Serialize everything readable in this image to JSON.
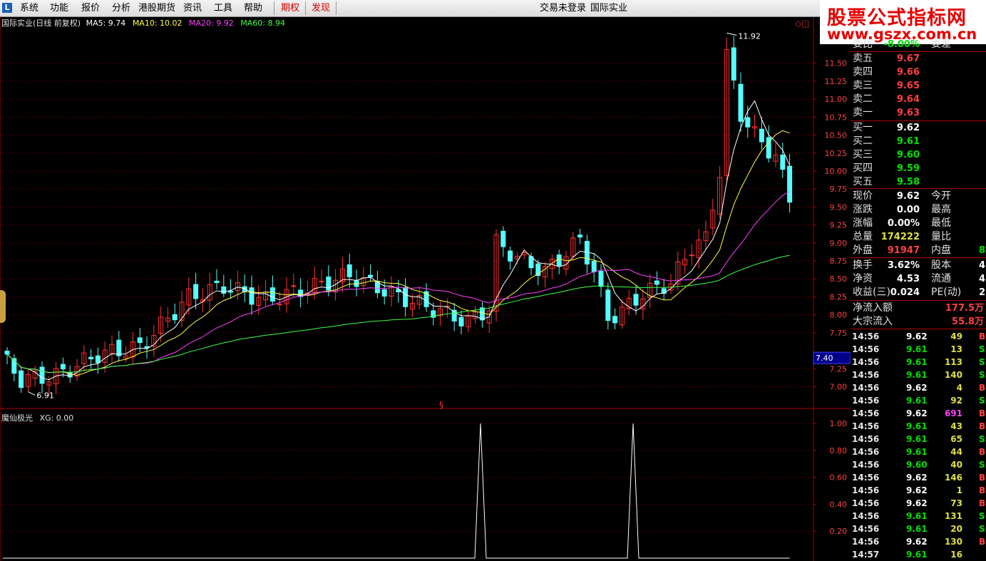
{
  "menubar": {
    "items": [
      "系统",
      "功能",
      "报价",
      "分析",
      "港股期货",
      "资讯",
      "工具",
      "帮助"
    ],
    "qiquan": "期权",
    "faxian": "发现",
    "login_status": "交易未登录",
    "stock_name": "国际实业"
  },
  "watermark": {
    "line1": "股票公式指标网",
    "line2": "www.gszx.com.cn"
  },
  "chart": {
    "header_title": "国际实业(日线 前复权)",
    "ma": [
      {
        "label": "MA5: 9.74",
        "color": "#ffffff"
      },
      {
        "label": "MA10: 10.02",
        "color": "#ffff40"
      },
      {
        "label": "MA20: 9.92",
        "color": "#ff40ff"
      },
      {
        "label": "MA60: 8.94",
        "color": "#40ff40"
      }
    ],
    "high_label": "11.92",
    "low_label": "6.91",
    "cursor_price": "7.40",
    "corner_icons": "◇□",
    "mid_marker": "§",
    "price_ticks": [
      "11.50",
      "11.25",
      "11.00",
      "10.75",
      "10.50",
      "10.25",
      "10.00",
      "9.75",
      "9.50",
      "9.25",
      "9.00",
      "8.75",
      "8.50",
      "8.25",
      "8.00",
      "7.75",
      "7.25",
      "7.00"
    ]
  },
  "indicator": {
    "title": "魔仙极光",
    "value_label": "XG: 0.00",
    "ticks": [
      "1.00",
      "0.80",
      "0.60",
      "0.40",
      "0.20"
    ]
  },
  "chart_data": [
    {
      "type": "candlestick",
      "title": "国际实业(日线 前复权)",
      "ylim": [
        6.85,
        11.95
      ],
      "series": [
        {
          "name": "MA5",
          "last": 9.74
        },
        {
          "name": "MA10",
          "last": 10.02
        },
        {
          "name": "MA20",
          "last": 9.92
        },
        {
          "name": "MA60",
          "last": 8.94
        }
      ],
      "high": 11.92,
      "low": 6.91
    },
    {
      "type": "line",
      "title": "魔仙极光",
      "series": [
        {
          "name": "XG",
          "last": 0.0
        }
      ],
      "ylim": [
        0,
        1.0
      ],
      "spikes_at_value": 1.0
    }
  ],
  "quote": {
    "top_partial": {
      "label": "委比",
      "value": "-8.00%",
      "label2": "委差"
    },
    "sell": [
      {
        "label": "卖五",
        "price": "9.67"
      },
      {
        "label": "卖四",
        "price": "9.66"
      },
      {
        "label": "卖三",
        "price": "9.65"
      },
      {
        "label": "卖二",
        "price": "9.64"
      },
      {
        "label": "卖一",
        "price": "9.63"
      }
    ],
    "buy": [
      {
        "label": "买一",
        "price": "9.62"
      },
      {
        "label": "买二",
        "price": "9.61"
      },
      {
        "label": "买三",
        "price": "9.60"
      },
      {
        "label": "买四",
        "price": "9.59"
      },
      {
        "label": "买五",
        "price": "9.58"
      }
    ],
    "stats": [
      {
        "label": "现价",
        "value": "9.62",
        "label2": "今开",
        "value2": ""
      },
      {
        "label": "涨跌",
        "value": "0.00",
        "label2": "最高",
        "value2": ""
      },
      {
        "label": "涨幅",
        "value": "0.00%",
        "label2": "最低",
        "value2": ""
      },
      {
        "label": "总量",
        "value": "174222",
        "label2": "量比",
        "value2": ""
      },
      {
        "label": "外盘",
        "value": "91947",
        "label2": "内盘",
        "value2": "8"
      }
    ],
    "stats2": [
      {
        "label": "换手",
        "value": "3.62%",
        "label2": "股本",
        "value2": "4."
      },
      {
        "label": "净资",
        "value": "4.53",
        "label2": "流通",
        "value2": "4."
      },
      {
        "label": "收益(三)",
        "value": "0.024",
        "label2": "PE(动)",
        "value2": "2"
      }
    ],
    "flow": [
      {
        "label": "净流入额",
        "value": "177.5万"
      },
      {
        "label": "大宗流入",
        "value": "55.8万"
      }
    ]
  },
  "trades": [
    {
      "time": "14:56",
      "price": "9.62",
      "vol": "49",
      "side": "B"
    },
    {
      "time": "14:56",
      "price": "9.61",
      "vol": "13",
      "side": "S"
    },
    {
      "time": "14:56",
      "price": "9.61",
      "vol": "113",
      "side": "S"
    },
    {
      "time": "14:56",
      "price": "9.61",
      "vol": "140",
      "side": "S"
    },
    {
      "time": "14:56",
      "price": "9.62",
      "vol": "4",
      "side": "B"
    },
    {
      "time": "14:56",
      "price": "9.61",
      "vol": "92",
      "side": "S"
    },
    {
      "time": "14:56",
      "price": "9.62",
      "vol": "691",
      "side": "B"
    },
    {
      "time": "14:56",
      "price": "9.61",
      "vol": "43",
      "side": "B"
    },
    {
      "time": "14:56",
      "price": "9.61",
      "vol": "65",
      "side": "S"
    },
    {
      "time": "14:56",
      "price": "9.61",
      "vol": "44",
      "side": "B"
    },
    {
      "time": "14:56",
      "price": "9.60",
      "vol": "40",
      "side": "S"
    },
    {
      "time": "14:56",
      "price": "9.62",
      "vol": "146",
      "side": "B"
    },
    {
      "time": "14:56",
      "price": "9.62",
      "vol": "1",
      "side": "B"
    },
    {
      "time": "14:56",
      "price": "9.62",
      "vol": "73",
      "side": "B"
    },
    {
      "time": "14:56",
      "price": "9.61",
      "vol": "131",
      "side": "S"
    },
    {
      "time": "14:56",
      "price": "9.61",
      "vol": "20",
      "side": "S"
    },
    {
      "time": "14:56",
      "price": "9.62",
      "vol": "130",
      "side": "B"
    },
    {
      "time": "14:57",
      "price": "9.61",
      "vol": "16",
      "side": ""
    }
  ],
  "colors": {
    "up": "#ff3030",
    "down": "#54ffff",
    "axis": "#b00000",
    "ma5": "#ffffff",
    "ma10": "#ffff40",
    "ma20": "#ff40ff",
    "ma60": "#40ff40"
  }
}
